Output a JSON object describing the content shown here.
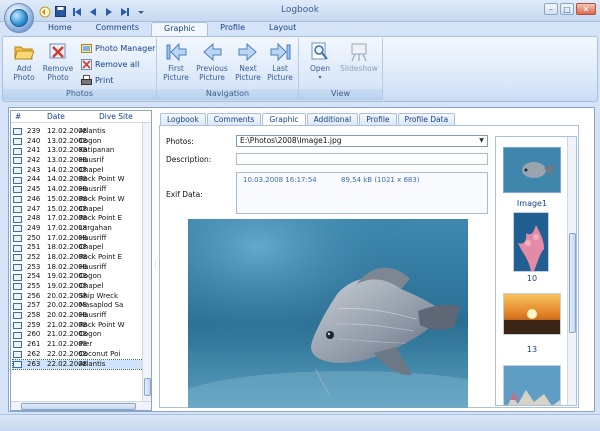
{
  "window": {
    "title": "Logbook"
  },
  "ribbon_tabs": [
    "Home",
    "Comments",
    "Graphic",
    "Profile",
    "Layout"
  ],
  "ribbon": {
    "photos_group": {
      "label": "Photos",
      "add": "Add Photo",
      "remove": "Remove Photo",
      "photo_manager": "Photo Manager",
      "remove_all": "Remove all",
      "print": "Print"
    },
    "navigation_group": {
      "label": "Navigation",
      "first": "First Picture",
      "previous": "Previous Picture",
      "next": "Next Picture",
      "last": "Last Picture"
    },
    "view_group": {
      "label": "View",
      "open": "Open",
      "slideshow": "Slideshow"
    }
  },
  "list": {
    "headers": [
      "#",
      "Date",
      "Dive Site"
    ],
    "rows": [
      [
        "239",
        "12.02.2008",
        "Atlantis"
      ],
      [
        "240",
        "13.02.2008",
        "Cogon"
      ],
      [
        "241",
        "13.02.2008",
        "Katipanan"
      ],
      [
        "242",
        "13.02.2008",
        "Hausrif"
      ],
      [
        "243",
        "14.02.2008",
        "Chapel"
      ],
      [
        "244",
        "14.02.2008",
        "Rock Point W"
      ],
      [
        "245",
        "14.02.2008",
        "Hausriff"
      ],
      [
        "246",
        "15.02.2008",
        "Rock Point W"
      ],
      [
        "247",
        "15.02.2008",
        "Chapel"
      ],
      [
        "248",
        "17.02.2008",
        "Rock Point E"
      ],
      [
        "249",
        "17.02.2008",
        "Largahan"
      ],
      [
        "250",
        "17.02.2008",
        "Hausriff"
      ],
      [
        "251",
        "18.02.2008",
        "Chapel"
      ],
      [
        "252",
        "18.02.2008",
        "Rock Point E"
      ],
      [
        "253",
        "18.02.2008",
        "Hausriff"
      ],
      [
        "254",
        "19.02.2008",
        "Cogon"
      ],
      [
        "255",
        "19.02.2008",
        "Chapel"
      ],
      [
        "256",
        "20.02.2008",
        "Ship Wreck"
      ],
      [
        "257",
        "20.02.2008",
        "Masaplod Sa"
      ],
      [
        "258",
        "20.02.2008",
        "Hausriff"
      ],
      [
        "259",
        "21.02.2008",
        "Rock Point W"
      ],
      [
        "260",
        "21.02.2008",
        "Cogon"
      ],
      [
        "261",
        "21.02.2008",
        "Pier"
      ],
      [
        "262",
        "22.02.2008",
        "Coconut Poi"
      ],
      [
        "263",
        "22.02.2008",
        "Atlantis"
      ]
    ],
    "selected_index": 24
  },
  "detail_tabs": [
    "Logbook",
    "Comments",
    "Graphic",
    "Additional",
    "Profile",
    "Profile Data"
  ],
  "graphic": {
    "photos_label": "Photos:",
    "photos_value": "E:\\Photos\\2008\\Image1.jpg",
    "description_label": "Description:",
    "exif_label": "Exif Data:",
    "exif_date": "10.03.2008 16:17:54",
    "exif_size": "89,54 kB (1021 x 683)"
  },
  "thumbnails": [
    "Image1",
    "10",
    "13"
  ],
  "colors": {
    "accent": "#15428b",
    "ribbon_bg": "#dbe8f8",
    "water": "#2a6e93"
  }
}
